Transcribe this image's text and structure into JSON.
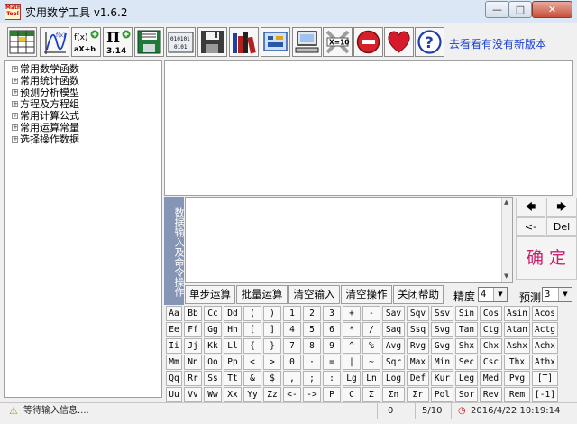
{
  "window": {
    "title": "实用数学工具 v1.6.2",
    "app_icon_text": "Math Tool",
    "controls": {
      "minimize": "—",
      "maximize": "□",
      "close": "✕"
    }
  },
  "toolbar": {
    "icons": [
      "table-grid-icon",
      "function-graph-icon",
      "linear-function-icon",
      "pi-icon",
      "save-floppy-icon",
      "binary-data-icon",
      "disk-icon",
      "books-icon",
      "screen-icon",
      "computer-icon",
      "calculator-icon",
      "stop-icon",
      "heart-icon",
      "help-icon"
    ],
    "linear_function_text": "f(x)\naX+b",
    "pi_value": "3.14",
    "binary_text": "010101\n0101",
    "calc_text": "X=10",
    "update_link": "去看看有没有新版本"
  },
  "tree": {
    "items": [
      "常用数学函数",
      "常用统计函数",
      "预测分析模型",
      "方程及方程组",
      "常用计算公式",
      "常用运算常量",
      "选择操作数据"
    ]
  },
  "input_panel": {
    "side_label": "数据输入及命令操作"
  },
  "arrows": {
    "left": "🡄",
    "right": "🡆",
    "backspace": "<-",
    "delete": "Del",
    "confirm": "确 定"
  },
  "controls": {
    "buttons": [
      "单步运算",
      "批量运算",
      "清空输入",
      "清空操作",
      "关闭帮助"
    ],
    "precision_label": "精度",
    "precision_value": "4",
    "predict_label": "预测",
    "predict_value": "3"
  },
  "keypad": [
    [
      "Aa",
      "Bb",
      "Cc",
      "Dd",
      "(",
      ")",
      "1",
      "2",
      "3",
      "+",
      "-",
      "Sav",
      "Sqv",
      "Ssv",
      "Sin",
      "Cos",
      "Asin",
      "Acos"
    ],
    [
      "Ee",
      "Ff",
      "Gg",
      "Hh",
      "[",
      "]",
      "4",
      "5",
      "6",
      "*",
      "/",
      "Saq",
      "Ssq",
      "Svg",
      "Tan",
      "Ctg",
      "Atan",
      "Actg"
    ],
    [
      "Ii",
      "Jj",
      "Kk",
      "Ll",
      "{",
      "}",
      "7",
      "8",
      "9",
      "^",
      "%",
      "Avg",
      "Rvg",
      "Gvg",
      "Shx",
      "Chx",
      "Ashx",
      "Achx"
    ],
    [
      "Mm",
      "Nn",
      "Oo",
      "Pp",
      "<",
      ">",
      "0",
      "·",
      "=",
      "|",
      "~",
      "Sqr",
      "Max",
      "Min",
      "Sec",
      "Csc",
      "Thx",
      "Athx"
    ],
    [
      "Qq",
      "Rr",
      "Ss",
      "Tt",
      "&",
      "$",
      ",",
      ";",
      ":",
      "Lg",
      "Ln",
      "Log",
      "Def",
      "Kur",
      "Leg",
      "Med",
      "Pvg",
      "[T]"
    ],
    [
      "Uu",
      "Vv",
      "Ww",
      "Xx",
      "Yy",
      "Zz",
      "<-",
      "->",
      "P",
      "C",
      "Σ",
      "Σn",
      "Σr",
      "Pol",
      "Sor",
      "Rev",
      "Rem",
      "[-1]"
    ]
  ],
  "statusbar": {
    "message": "等待输入信息....",
    "count": "0",
    "page": "5/10",
    "datetime": "2016/4/22  10:19:14"
  }
}
